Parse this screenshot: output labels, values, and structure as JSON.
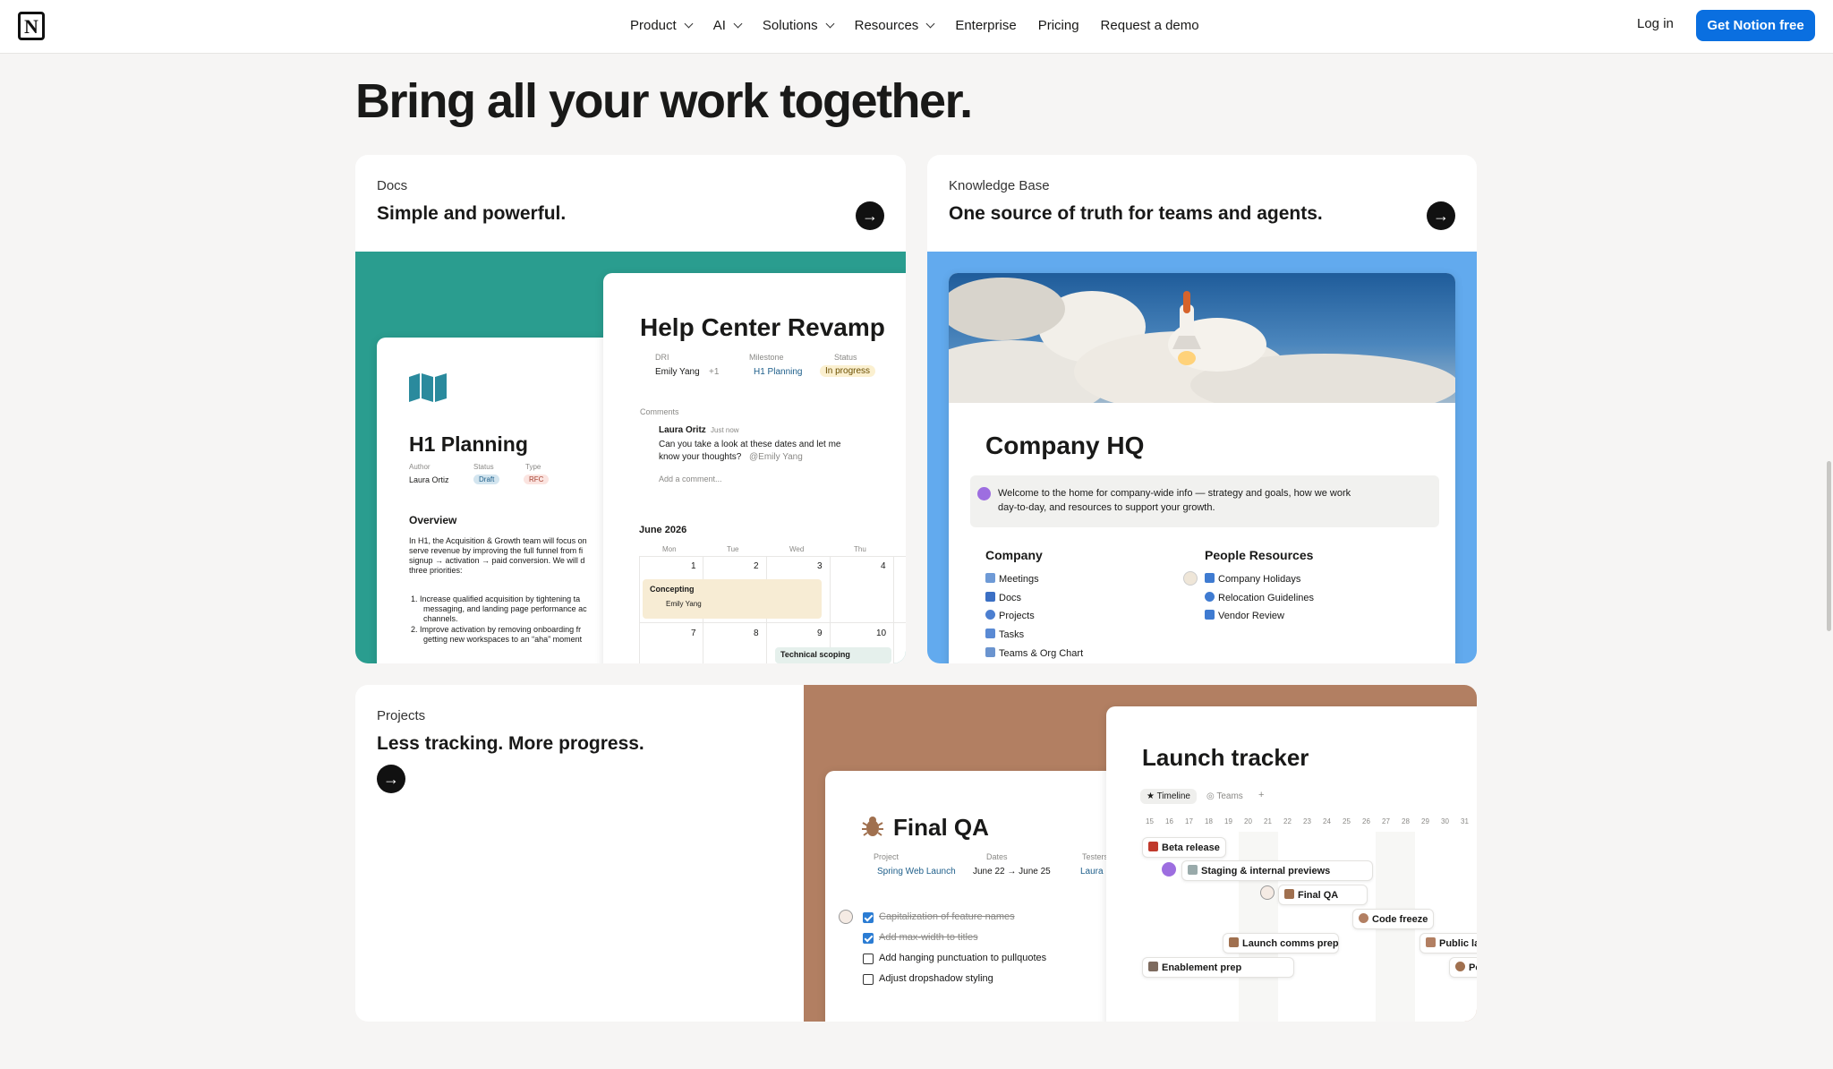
{
  "nav": {
    "items": [
      {
        "label": "Product",
        "dropdown": true
      },
      {
        "label": "AI",
        "dropdown": true
      },
      {
        "label": "Solutions",
        "dropdown": true
      },
      {
        "label": "Resources",
        "dropdown": true
      },
      {
        "label": "Enterprise",
        "dropdown": false
      },
      {
        "label": "Pricing",
        "dropdown": false
      },
      {
        "label": "Request a demo",
        "dropdown": false
      }
    ],
    "login": "Log in",
    "cta": "Get Notion free"
  },
  "headline": "Bring all your work together.",
  "cards": {
    "docs": {
      "eyebrow": "Docs",
      "title": "Simple and powerful.",
      "bg": "#2a9d8f"
    },
    "kb": {
      "eyebrow": "Knowledge Base",
      "title": "One source of truth for teams and agents.",
      "bg": "#62aaee"
    },
    "projects": {
      "eyebrow": "Projects",
      "title": "Less tracking. More progress.",
      "bg": "#b27f62"
    }
  },
  "h1": {
    "title": "H1 Planning",
    "props": {
      "author_label": "Author",
      "author": "Laura Ortiz",
      "status_label": "Status",
      "status": "Draft",
      "type_label": "Type",
      "type": "RFC"
    },
    "overview": "Overview",
    "body": [
      "In H1, the Acquisition & Growth team will focus on",
      "serve revenue by improving the full funnel from fi",
      "signup → activation → paid conversion. We will d",
      "three priorities:"
    ],
    "list": [
      "1.  Increase qualified acquisition by tightening ta",
      "messaging, and landing page performance ac",
      "channels.",
      "2.  Improve activation by removing onboarding fr",
      "getting new workspaces to an “aha” moment"
    ]
  },
  "help": {
    "title": "Help Center Revamp",
    "dri_label": "DRI",
    "dri": "Emily Yang",
    "dri_extra": "+1",
    "milestone_label": "Milestone",
    "milestone": "H1 Planning",
    "status_label": "Status",
    "status": "In progress",
    "comments_label": "Comments",
    "comment_author": "Laura Oritz",
    "comment_time": "Just now",
    "comment_text1": "Can you take a look at these dates and let me",
    "comment_text2": "know your thoughts?",
    "comment_mention": "@Emily Yang",
    "add_comment": "Add a comment...",
    "month": "June 2026",
    "days": [
      "Mon",
      "Tue",
      "Wed",
      "Thu"
    ],
    "row1": [
      "1",
      "2",
      "3",
      "4"
    ],
    "row2": [
      "7",
      "8",
      "9",
      "10"
    ],
    "event1": "Concepting",
    "event1_person": "Emily Yang",
    "event2": "Technical scoping"
  },
  "hq": {
    "title": "Company HQ",
    "callout": [
      "Welcome to the home for company-wide info — strategy and goals, how we work",
      "day-to-day, and resources to support your growth."
    ],
    "company_heading": "Company",
    "company_items": [
      "Meetings",
      "Docs",
      "Projects",
      "Tasks",
      "Teams & Org Chart"
    ],
    "people_heading": "People Resources",
    "people_items": [
      "Company Holidays",
      "Relocation Guidelines",
      "Vendor Review"
    ]
  },
  "qa": {
    "title": "Final QA",
    "project_label": "Project",
    "project": "Spring Web Launch",
    "dates_label": "Dates",
    "dates": "June 22 → June 25",
    "testers_label": "Testers",
    "tester": "Laura",
    "tasks": [
      {
        "text": "Capitalization of feature names",
        "done": true
      },
      {
        "text": "Add max-width to titles",
        "done": true
      },
      {
        "text": "Add hanging punctuation to pullquotes",
        "done": false
      },
      {
        "text": "Adjust dropshadow styling",
        "done": false
      }
    ]
  },
  "tracker": {
    "title": "Launch tracker",
    "tab1": "Timeline",
    "tab2": "Teams",
    "tab_add": "+",
    "dates": [
      "15",
      "16",
      "17",
      "18",
      "19",
      "20",
      "21",
      "22",
      "23",
      "24",
      "25",
      "26",
      "27",
      "28",
      "29",
      "30",
      "31"
    ],
    "bars": [
      "Beta release",
      "Staging & internal previews",
      "Final QA",
      "Code freeze",
      "Launch comms prep",
      "Public la",
      "Enablement prep",
      "Po"
    ]
  }
}
